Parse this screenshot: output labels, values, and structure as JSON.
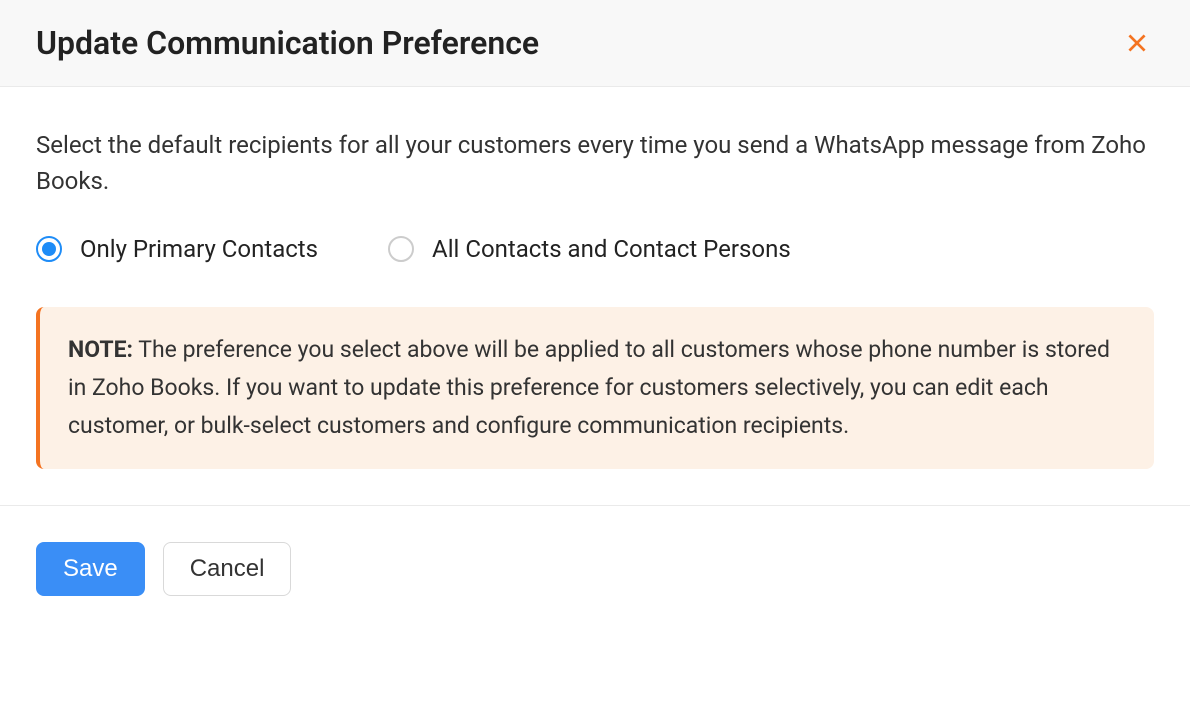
{
  "modal": {
    "title": "Update Communication Preference",
    "description": "Select the default recipients for all your customers every time you send a WhatsApp message from Zoho Books.",
    "options": {
      "primary": "Only Primary Contacts",
      "all": "All Contacts and Contact Persons",
      "selected": "primary"
    },
    "note": {
      "label": "NOTE:",
      "text": "The preference you select above will be applied to all customers whose phone number is stored in Zoho Books. If you want to update this preference for customers selectively, you can edit each customer, or bulk-select customers and configure communication recipients."
    },
    "buttons": {
      "save": "Save",
      "cancel": "Cancel"
    }
  }
}
